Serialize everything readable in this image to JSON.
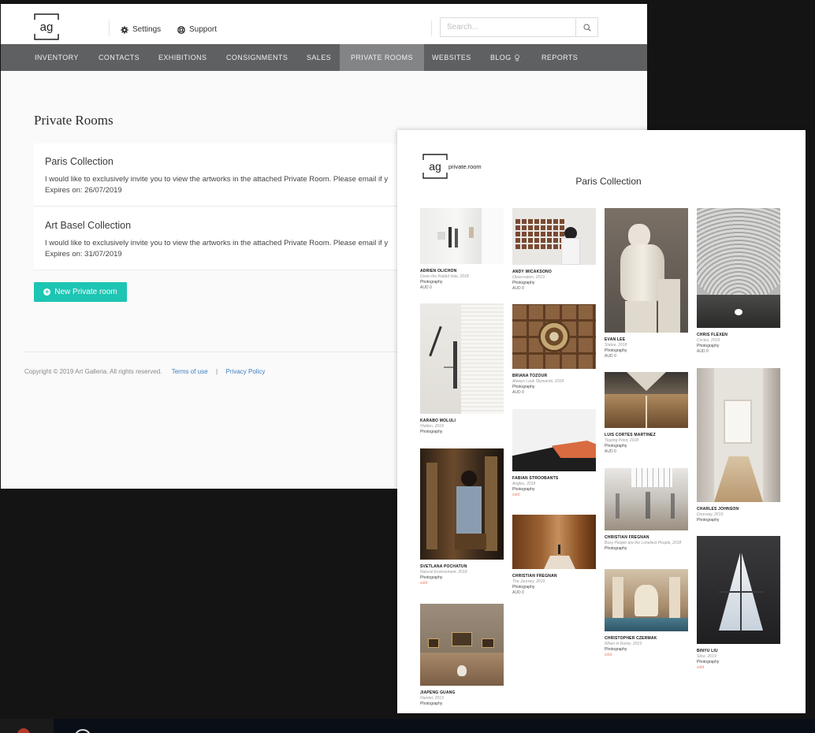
{
  "app": {
    "logo_text": "ag",
    "settings_label": "Settings",
    "support_label": "Support",
    "search_placeholder": "Search...",
    "nav": [
      {
        "label": "INVENTORY"
      },
      {
        "label": "CONTACTS"
      },
      {
        "label": "EXHIBITIONS"
      },
      {
        "label": "CONSIGNMENTS"
      },
      {
        "label": "SALES"
      },
      {
        "label": "PRIVATE ROOMS",
        "active": true
      },
      {
        "label": "WEBSITES"
      },
      {
        "label": "BLOG"
      },
      {
        "label": "REPORTS"
      }
    ]
  },
  "main": {
    "page_title": "Private Rooms",
    "rooms": [
      {
        "title": "Paris Collection",
        "message": "I would like to exclusively invite you to view the artworks in the attached Private Room. Please email if y",
        "expires": "Expires on: 26/07/2019"
      },
      {
        "title": "Art Basel Collection",
        "message": "I would like to exclusively invite you to view the artworks in the attached Private Room. Please email if y",
        "expires": "Expires on: 31/07/2019"
      }
    ],
    "new_room_label": "New Private room"
  },
  "footer": {
    "copyright": "Copyright © 2019 Art Galleria. All rights reserved.",
    "terms": "Terms of use",
    "separator": "|",
    "privacy": "Privacy Policy"
  },
  "private_room": {
    "logo_text": "ag",
    "logo_suffix": "private.room",
    "title": "Paris Collection",
    "artworks": [
      {
        "artist": "ADRIEN OLICHON",
        "title": "Down the Rabbit hole, 2018",
        "medium": "Photography",
        "price": "AUD 0"
      },
      {
        "artist": "KARABO MOLULI",
        "title": "Hidden, 2018",
        "medium": "Photography",
        "price": ""
      },
      {
        "artist": "SVETLANA POCHATUN",
        "title": "Natural Environment, 2018",
        "medium": "Photography",
        "price": "sold"
      },
      {
        "artist": "JIAPENG GUANG",
        "title": "Hamlet, 2019",
        "medium": "Photography",
        "price": ""
      },
      {
        "artist": "ANDY WICAKSONO",
        "title": "Observation, 2019",
        "medium": "Photography",
        "price": "AUD 0"
      },
      {
        "artist": "BRIANA TOZOUR",
        "title": "Always Look Skywards, 2018",
        "medium": "Photography",
        "price": "AUD 0"
      },
      {
        "artist": "FABIAN STROOBANTS",
        "title": "Angles, 2018",
        "medium": "Photography",
        "price": "sold"
      },
      {
        "artist": "CHRISTIAN FREGNAN",
        "title": "The Journey, 2019",
        "medium": "Photography",
        "price": "AUD 0"
      },
      {
        "artist": "EVAN LEE",
        "title": "Statue, 2018",
        "medium": "Photography",
        "price": "AUD 0"
      },
      {
        "artist": "LUIS CORTES MARTINEZ",
        "title": "Tipping Point, 2018",
        "medium": "Photography",
        "price": "AUD 0"
      },
      {
        "artist": "CHRISTIAN FREGNAN",
        "title": "Busy People are the Loneliest People, 2018",
        "medium": "Photography",
        "price": ""
      },
      {
        "artist": "CHRISTOPHER CZERMAK",
        "title": "When in Rome, 2019",
        "medium": "Photography",
        "price": "sold"
      },
      {
        "artist": "CHRIS FLEXEN",
        "title": "Circles, 2019",
        "medium": "Photography",
        "price": "AUD 0"
      },
      {
        "artist": "CHARLES JOHNSON",
        "title": "Doorway, 2019",
        "medium": "Photography",
        "price": ""
      },
      {
        "artist": "BINYU LIU",
        "title": "Slice, 2019",
        "medium": "Photography",
        "price": "sold"
      }
    ]
  },
  "colors": {
    "accent": "#1dc5b3",
    "nav_bg": "#5f6061",
    "nav_active": "#838485",
    "link": "#3f7fbf",
    "sold": "#e8846c"
  }
}
